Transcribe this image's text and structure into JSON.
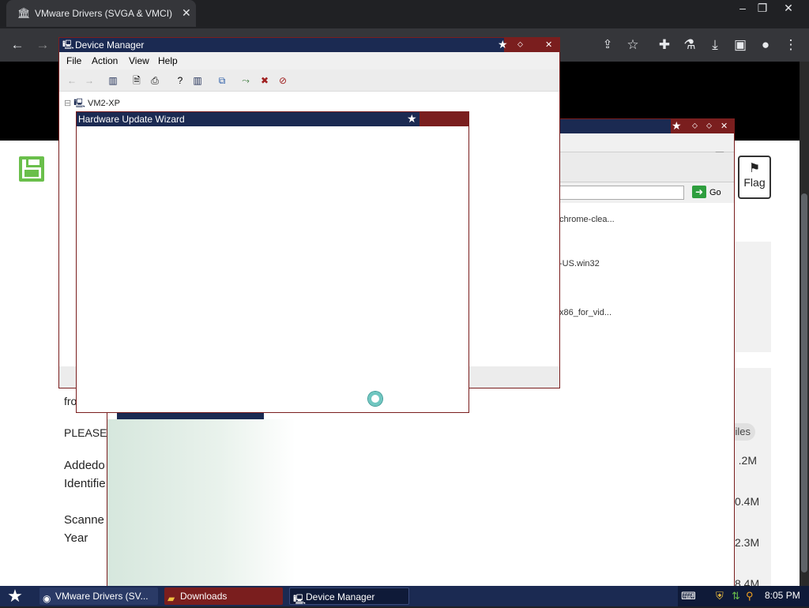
{
  "browser": {
    "tab_title": "VMware Drivers (SVGA & VMCI) for",
    "tab_icon": "bank-icon",
    "window_controls": [
      "–",
      "❐",
      "✕"
    ],
    "toolbar_icons": [
      "back-icon",
      "forward-icon",
      "share-icon",
      "star-icon",
      "extensions-icon",
      "labs-icon",
      "download-icon",
      "sidepanel-icon",
      "profile-icon",
      "menu-icon"
    ]
  },
  "page": {
    "flag_label": "Flag",
    "text_lines": [
      "fro",
      "PLEASE",
      "Addedo",
      "Identifie",
      "Scanne",
      "Year"
    ],
    "files_pill": "iles",
    "sizes": [
      ".2M",
      "0.4M",
      "2.3M",
      "8.4M"
    ]
  },
  "ie_window": {
    "go_label": "Go",
    "files": [
      "chrome-clea...",
      "-US.win32",
      "x86_for_vid..."
    ]
  },
  "device_manager": {
    "title": "Device Manager",
    "menus": [
      "File",
      "Action",
      "View",
      "Help"
    ],
    "tree_root": "VM2-XP"
  },
  "wizard": {
    "title": "Hardware Update Wizard"
  },
  "taskbar": {
    "items": [
      "VMware Drivers (SV...",
      "Downloads",
      "Device Manager"
    ],
    "clock": "8:05 PM"
  },
  "colors": {
    "xp_title": "#1b2a52",
    "xp_stripe": "#7a1e1e",
    "chrome_dark": "#202124",
    "save_green": "#6abf4b"
  }
}
